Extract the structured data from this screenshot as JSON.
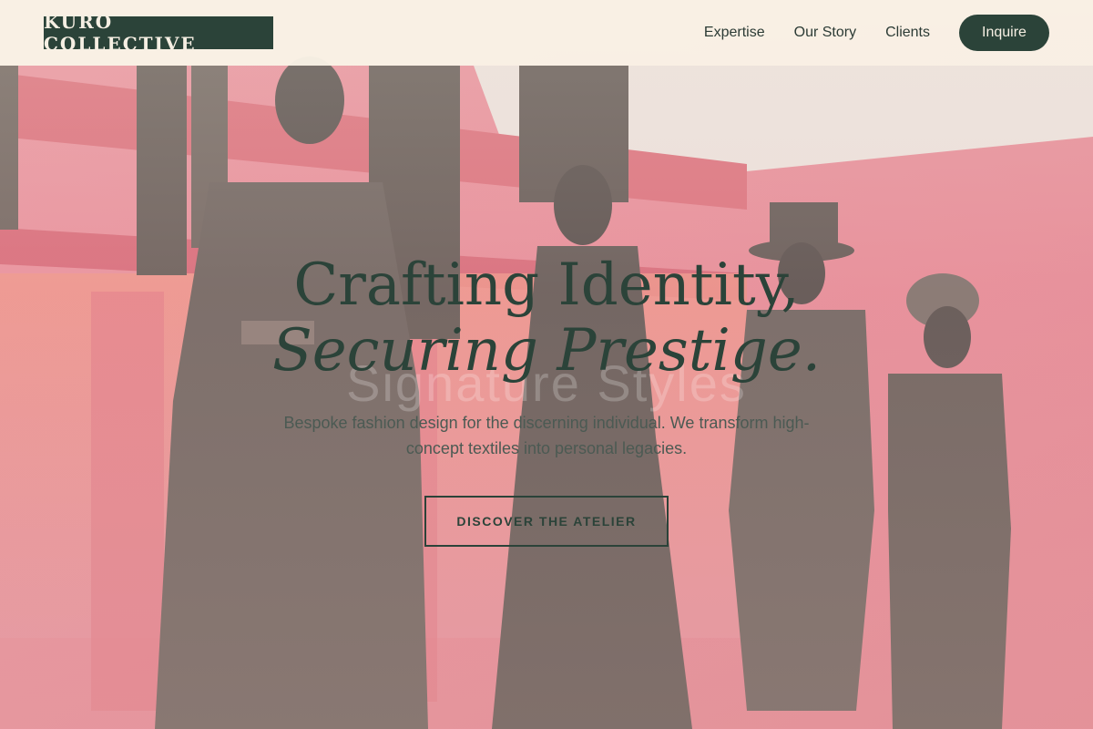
{
  "header": {
    "logo": "KURO COLLECTIVE",
    "nav": [
      {
        "label": "Expertise"
      },
      {
        "label": "Our Story"
      },
      {
        "label": "Clients"
      }
    ],
    "cta_label": "Inquire"
  },
  "hero": {
    "headline_line1": "Crafting Identity,",
    "headline_line2": "Securing Prestige.",
    "watermark": "Signature Styles",
    "subtitle": "Bespoke fashion design for the discerning individual. We transform high-concept textiles into personal legacies.",
    "cta_label": "DISCOVER THE ATELIER"
  },
  "colors": {
    "brand_dark_green": "#2b4339",
    "header_cream": "#f9f2e6",
    "backdrop_pink": "#e07a8a"
  }
}
